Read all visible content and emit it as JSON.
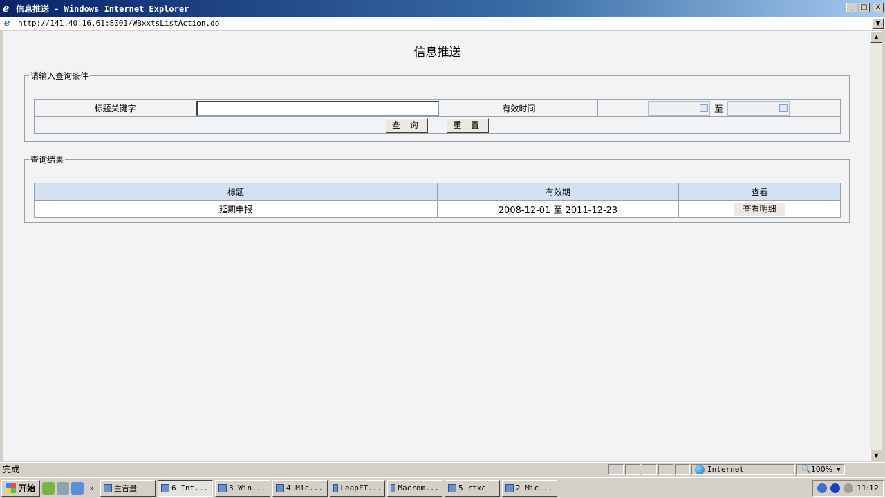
{
  "window": {
    "title": "信息推送 - Windows Internet Explorer",
    "minimize": "_",
    "maximize": "□",
    "close": "X"
  },
  "address": {
    "url": "http://141.40.16.61:8001/WBxxtsListAction.do"
  },
  "page": {
    "title": "信息推送",
    "search_section": {
      "legend": "请输入查询条件",
      "keyword_label": "标题关键字",
      "keyword_value": "",
      "valid_time_label": "有效时间",
      "date_from": "",
      "date_sep": "至",
      "date_to": "",
      "query_button": "查 询",
      "reset_button": "重 置"
    },
    "results_section": {
      "legend": "查询结果",
      "columns": [
        "标题",
        "有效期",
        "查看"
      ],
      "rows": [
        {
          "title": "延期申报",
          "start": "2008-12-01",
          "sep": "至",
          "end": "2011-12-23",
          "action": "查看明细"
        }
      ]
    }
  },
  "statusbar": {
    "status": "完成",
    "zone": "Internet",
    "zoom": "100%"
  },
  "taskbar": {
    "start": "开始",
    "tasks": [
      "主音量",
      "6 Int...",
      "3 Win...",
      "4 Mic...",
      "LeapFT...",
      "Macrom...",
      "5 rtxc",
      "2 Mic..."
    ],
    "clock": "11:12"
  }
}
